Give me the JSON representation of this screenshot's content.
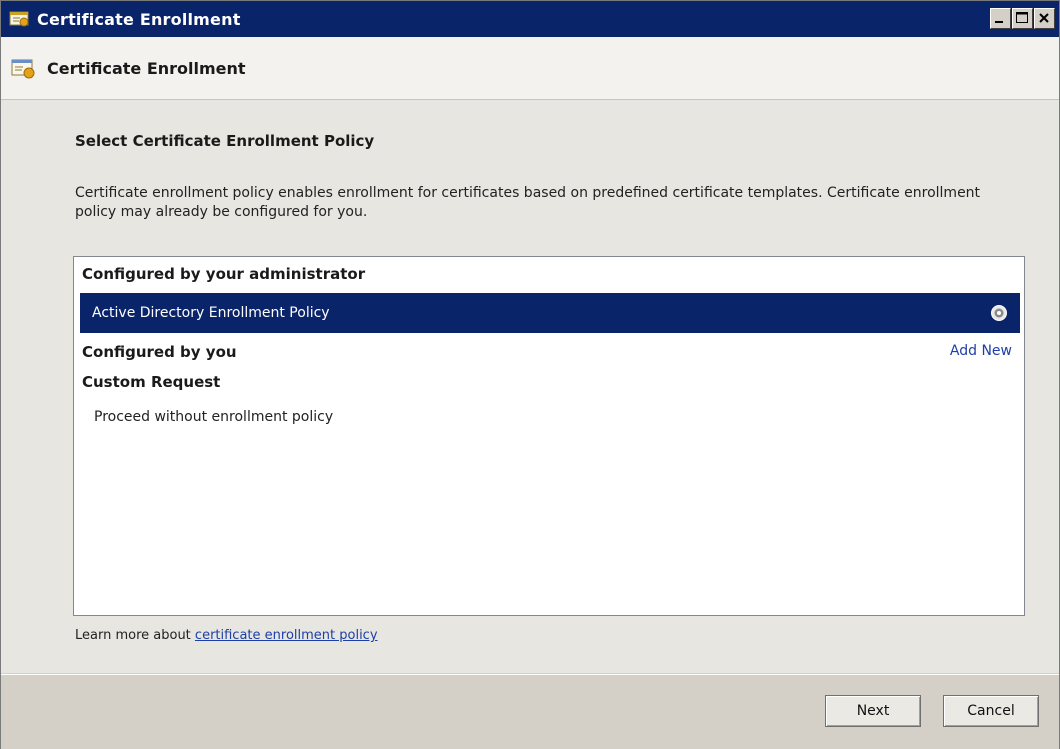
{
  "window": {
    "title": "Certificate Enrollment",
    "controls": [
      "minimize-icon",
      "maximize-icon",
      "close-icon"
    ]
  },
  "header": {
    "title": "Certificate Enrollment",
    "icon": "certificate-icon"
  },
  "page": {
    "heading": "Select Certificate Enrollment Policy",
    "description": "Certificate enrollment policy enables enrollment for certificates based on predefined certificate templates. Certificate enrollment policy may already be configured for you."
  },
  "policy_list": {
    "group_admin": "Configured by your administrator",
    "selected_policy": "Active Directory Enrollment Policy",
    "selected_policy_icon": "status-info-icon",
    "group_you": "Configured by you",
    "add_new": "Add New",
    "group_custom": "Custom Request",
    "proceed_item": "Proceed without enrollment policy"
  },
  "learn_more": {
    "prefix": "Learn more about ",
    "link": "certificate enrollment policy"
  },
  "footer": {
    "next_label": "Next",
    "cancel_label": "Cancel"
  },
  "colors": {
    "titlebar": "#0a246a",
    "selection": "#0a246a",
    "link": "#1c3fa8",
    "dialog_background": "#d4d0c8"
  }
}
